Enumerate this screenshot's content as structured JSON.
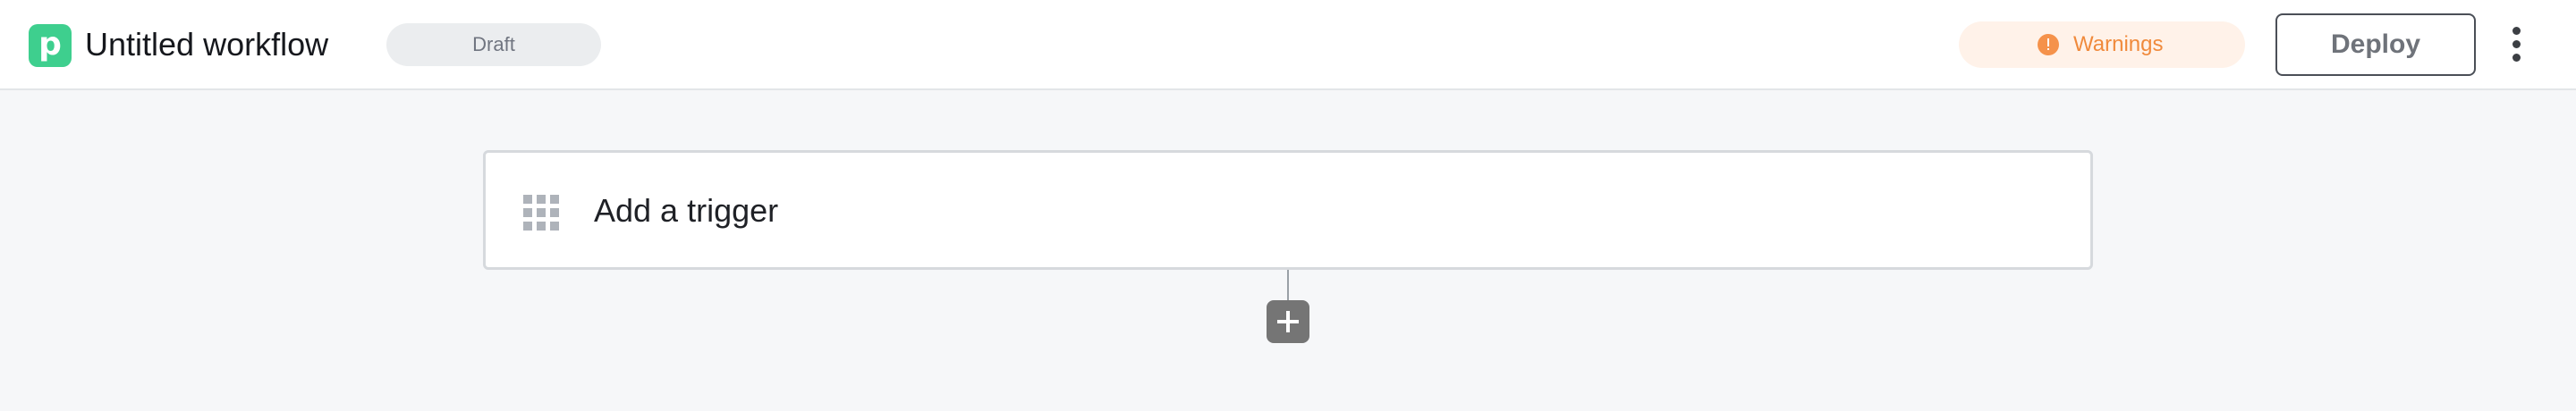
{
  "header": {
    "logo_letter": "p",
    "title": "Untitled workflow",
    "status_badge": "Draft",
    "warnings_label": "Warnings",
    "deploy_label": "Deploy",
    "more_icon": "more-vertical-icon",
    "warning_icon": "warning-circle-icon"
  },
  "canvas": {
    "trigger_label": "Add a trigger",
    "trigger_icon": "apps-grid-icon",
    "add_step_icon": "plus-icon"
  },
  "colors": {
    "brand": "#3ecf8e",
    "warning_text": "#f08a3c",
    "warning_bg": "#fff2e9",
    "canvas_bg": "#f6f7f9",
    "add_step_bg": "#757575"
  }
}
